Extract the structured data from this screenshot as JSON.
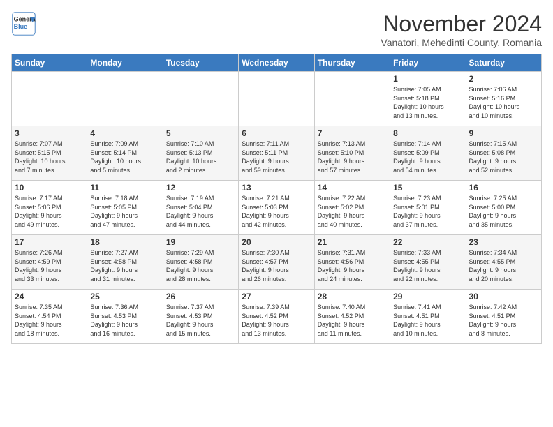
{
  "header": {
    "logo_line1": "General",
    "logo_line2": "Blue",
    "month": "November 2024",
    "location": "Vanatori, Mehedinti County, Romania"
  },
  "weekdays": [
    "Sunday",
    "Monday",
    "Tuesday",
    "Wednesday",
    "Thursday",
    "Friday",
    "Saturday"
  ],
  "weeks": [
    [
      {
        "day": "",
        "info": ""
      },
      {
        "day": "",
        "info": ""
      },
      {
        "day": "",
        "info": ""
      },
      {
        "day": "",
        "info": ""
      },
      {
        "day": "",
        "info": ""
      },
      {
        "day": "1",
        "info": "Sunrise: 7:05 AM\nSunset: 5:18 PM\nDaylight: 10 hours\nand 13 minutes."
      },
      {
        "day": "2",
        "info": "Sunrise: 7:06 AM\nSunset: 5:16 PM\nDaylight: 10 hours\nand 10 minutes."
      }
    ],
    [
      {
        "day": "3",
        "info": "Sunrise: 7:07 AM\nSunset: 5:15 PM\nDaylight: 10 hours\nand 7 minutes."
      },
      {
        "day": "4",
        "info": "Sunrise: 7:09 AM\nSunset: 5:14 PM\nDaylight: 10 hours\nand 5 minutes."
      },
      {
        "day": "5",
        "info": "Sunrise: 7:10 AM\nSunset: 5:13 PM\nDaylight: 10 hours\nand 2 minutes."
      },
      {
        "day": "6",
        "info": "Sunrise: 7:11 AM\nSunset: 5:11 PM\nDaylight: 9 hours\nand 59 minutes."
      },
      {
        "day": "7",
        "info": "Sunrise: 7:13 AM\nSunset: 5:10 PM\nDaylight: 9 hours\nand 57 minutes."
      },
      {
        "day": "8",
        "info": "Sunrise: 7:14 AM\nSunset: 5:09 PM\nDaylight: 9 hours\nand 54 minutes."
      },
      {
        "day": "9",
        "info": "Sunrise: 7:15 AM\nSunset: 5:08 PM\nDaylight: 9 hours\nand 52 minutes."
      }
    ],
    [
      {
        "day": "10",
        "info": "Sunrise: 7:17 AM\nSunset: 5:06 PM\nDaylight: 9 hours\nand 49 minutes."
      },
      {
        "day": "11",
        "info": "Sunrise: 7:18 AM\nSunset: 5:05 PM\nDaylight: 9 hours\nand 47 minutes."
      },
      {
        "day": "12",
        "info": "Sunrise: 7:19 AM\nSunset: 5:04 PM\nDaylight: 9 hours\nand 44 minutes."
      },
      {
        "day": "13",
        "info": "Sunrise: 7:21 AM\nSunset: 5:03 PM\nDaylight: 9 hours\nand 42 minutes."
      },
      {
        "day": "14",
        "info": "Sunrise: 7:22 AM\nSunset: 5:02 PM\nDaylight: 9 hours\nand 40 minutes."
      },
      {
        "day": "15",
        "info": "Sunrise: 7:23 AM\nSunset: 5:01 PM\nDaylight: 9 hours\nand 37 minutes."
      },
      {
        "day": "16",
        "info": "Sunrise: 7:25 AM\nSunset: 5:00 PM\nDaylight: 9 hours\nand 35 minutes."
      }
    ],
    [
      {
        "day": "17",
        "info": "Sunrise: 7:26 AM\nSunset: 4:59 PM\nDaylight: 9 hours\nand 33 minutes."
      },
      {
        "day": "18",
        "info": "Sunrise: 7:27 AM\nSunset: 4:58 PM\nDaylight: 9 hours\nand 31 minutes."
      },
      {
        "day": "19",
        "info": "Sunrise: 7:29 AM\nSunset: 4:58 PM\nDaylight: 9 hours\nand 28 minutes."
      },
      {
        "day": "20",
        "info": "Sunrise: 7:30 AM\nSunset: 4:57 PM\nDaylight: 9 hours\nand 26 minutes."
      },
      {
        "day": "21",
        "info": "Sunrise: 7:31 AM\nSunset: 4:56 PM\nDaylight: 9 hours\nand 24 minutes."
      },
      {
        "day": "22",
        "info": "Sunrise: 7:33 AM\nSunset: 4:55 PM\nDaylight: 9 hours\nand 22 minutes."
      },
      {
        "day": "23",
        "info": "Sunrise: 7:34 AM\nSunset: 4:55 PM\nDaylight: 9 hours\nand 20 minutes."
      }
    ],
    [
      {
        "day": "24",
        "info": "Sunrise: 7:35 AM\nSunset: 4:54 PM\nDaylight: 9 hours\nand 18 minutes."
      },
      {
        "day": "25",
        "info": "Sunrise: 7:36 AM\nSunset: 4:53 PM\nDaylight: 9 hours\nand 16 minutes."
      },
      {
        "day": "26",
        "info": "Sunrise: 7:37 AM\nSunset: 4:53 PM\nDaylight: 9 hours\nand 15 minutes."
      },
      {
        "day": "27",
        "info": "Sunrise: 7:39 AM\nSunset: 4:52 PM\nDaylight: 9 hours\nand 13 minutes."
      },
      {
        "day": "28",
        "info": "Sunrise: 7:40 AM\nSunset: 4:52 PM\nDaylight: 9 hours\nand 11 minutes."
      },
      {
        "day": "29",
        "info": "Sunrise: 7:41 AM\nSunset: 4:51 PM\nDaylight: 9 hours\nand 10 minutes."
      },
      {
        "day": "30",
        "info": "Sunrise: 7:42 AM\nSunset: 4:51 PM\nDaylight: 9 hours\nand 8 minutes."
      }
    ]
  ]
}
